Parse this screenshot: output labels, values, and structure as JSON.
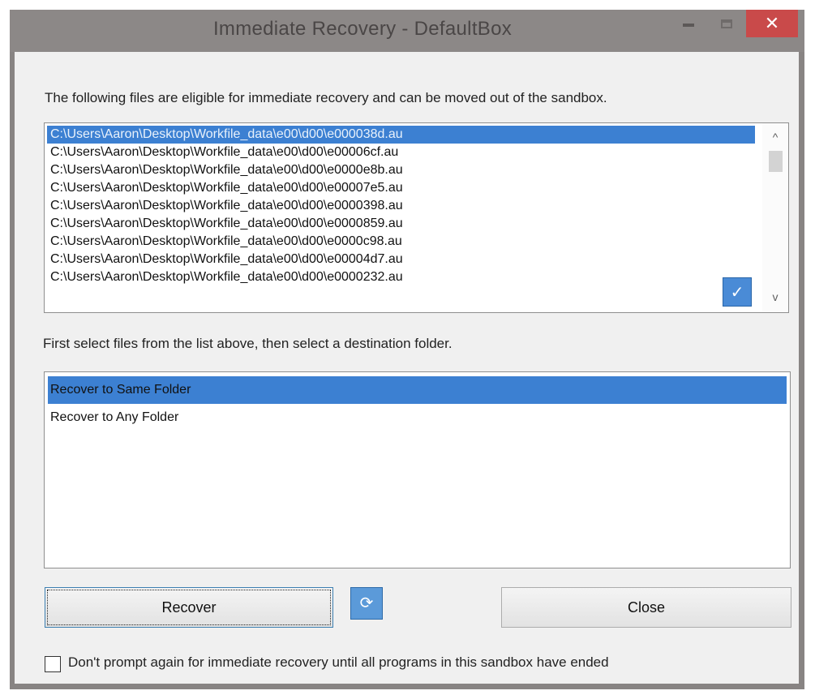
{
  "window": {
    "title": "Immediate Recovery - DefaultBox",
    "close_glyph": "✕"
  },
  "dialog": {
    "instruction_files": "The following files are eligible for immediate recovery and can be moved out of the sandbox.",
    "instruction_destination": "First select files from the list above, then select a destination folder.",
    "files": [
      "C:\\Users\\Aaron\\Desktop\\Workfile_data\\e00\\d00\\e000038d.au",
      "C:\\Users\\Aaron\\Desktop\\Workfile_data\\e00\\d00\\e00006cf.au",
      "C:\\Users\\Aaron\\Desktop\\Workfile_data\\e00\\d00\\e0000e8b.au",
      "C:\\Users\\Aaron\\Desktop\\Workfile_data\\e00\\d00\\e00007e5.au",
      "C:\\Users\\Aaron\\Desktop\\Workfile_data\\e00\\d00\\e0000398.au",
      "C:\\Users\\Aaron\\Desktop\\Workfile_data\\e00\\d00\\e0000859.au",
      "C:\\Users\\Aaron\\Desktop\\Workfile_data\\e00\\d00\\e0000c98.au",
      "C:\\Users\\Aaron\\Desktop\\Workfile_data\\e00\\d00\\e00004d7.au",
      "C:\\Users\\Aaron\\Desktop\\Workfile_data\\e00\\d00\\e0000232.au"
    ],
    "destinations": [
      "Recover to Same Folder",
      "Recover to Any Folder"
    ],
    "recover_button": "Recover",
    "close_button": "Close",
    "checkbox_label": "Don't prompt again for immediate recovery until all programs in this sandbox have ended",
    "checkbox_checked": false
  },
  "icons": {
    "scroll_up": "^",
    "scroll_down": "v",
    "select_check": "✓",
    "refresh": "⟳"
  },
  "colors": {
    "selection": "#3c80d2",
    "close_button_bg": "#c94a4a"
  }
}
